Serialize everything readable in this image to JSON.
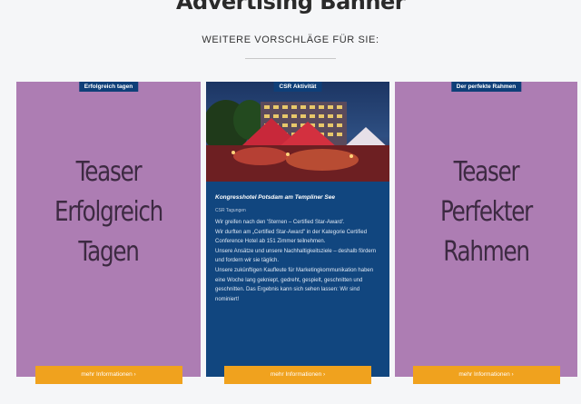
{
  "banner_title": "Advertising Banner",
  "section_title": "WEITERE VORSCHLÄGE FÜR SIE:",
  "cards": [
    {
      "tag": "Erfolgreich tagen",
      "teaser_lines": [
        "Teaser",
        "Erfolgreich",
        "Tagen"
      ],
      "cta": "mehr Informationen ›"
    },
    {
      "tag": "CSR Aktivität",
      "heading": "Kongresshotel Potsdam am Templiner See",
      "meta": "CSR Tagungen",
      "body": "Wir greifen nach den 'Sternen – Certified Star-Award'.\nWir durften am „Certified Star-Award\" in der Kategorie Certified Conference Hotel ab 151 Zimmer teilnehmen.\nUnsere Ansätze und unsere Nachhaltigkeitsziele – deshalb fördern und fordern wir sie täglich.\nUnsere zukünftigen Kaufleute für Marketingkommunikation haben eine Woche lang gekniept, gedreht, gespielt, geschnitten und geschnitten. Das Ergebnis kann sich sehen lassen: Wir sind nominiert!",
      "cta": "mehr Informationen ›"
    },
    {
      "tag": "Der perfekte Rahmen",
      "teaser_lines": [
        "Teaser",
        "Perfekter",
        "Rahmen"
      ],
      "cta": "mehr Informationen ›"
    }
  ],
  "colors": {
    "teaser_bg": "#ad7db3",
    "navy": "#11467f",
    "cta": "#f0a21e"
  }
}
